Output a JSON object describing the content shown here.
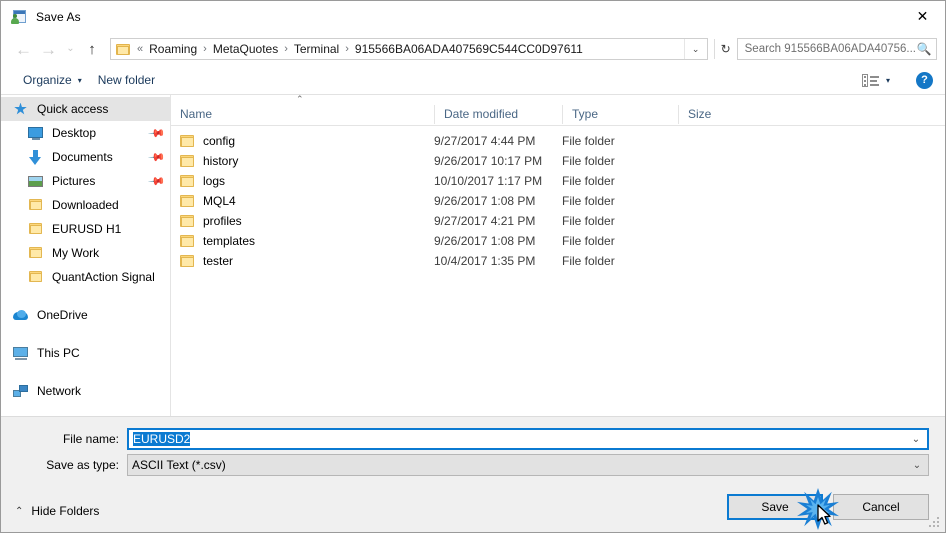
{
  "window": {
    "title": "Save As",
    "icon": "save-as-icon",
    "close_label": "✕"
  },
  "nav": {
    "back_icon": "←",
    "forward_icon": "→",
    "recent_icon": "⌄",
    "up_icon": "↑",
    "refresh_icon": "↻",
    "dropdown_icon": "⌄"
  },
  "address": {
    "leading_separator": "«",
    "crumbs": [
      "Roaming",
      "MetaQuotes",
      "Terminal",
      "915566BA06ADA407569C544CC0D97611"
    ],
    "separator": "›"
  },
  "search": {
    "placeholder": "Search 915566BA06ADA40756...",
    "icon": "search-icon"
  },
  "toolbar": {
    "organize_label": "Organize",
    "organize_caret": "▾",
    "new_folder_label": "New folder",
    "view_caret": "▾",
    "help_label": "?"
  },
  "sidebar": {
    "items": [
      {
        "label": "Quick access",
        "icon": "star-icon",
        "level": "root",
        "selected": true,
        "pinned": false
      },
      {
        "label": "Desktop",
        "icon": "desktop-icon",
        "level": "child",
        "selected": false,
        "pinned": true
      },
      {
        "label": "Documents",
        "icon": "download-arrow-icon",
        "level": "child",
        "selected": false,
        "pinned": true
      },
      {
        "label": "Pictures",
        "icon": "pictures-icon",
        "level": "child",
        "selected": false,
        "pinned": true
      },
      {
        "label": "Downloaded",
        "icon": "folder-icon",
        "level": "child",
        "selected": false,
        "pinned": false
      },
      {
        "label": "EURUSD H1",
        "icon": "folder-icon",
        "level": "child",
        "selected": false,
        "pinned": false
      },
      {
        "label": "My Work",
        "icon": "folder-icon",
        "level": "child",
        "selected": false,
        "pinned": false
      },
      {
        "label": "QuantAction Signal",
        "icon": "folder-icon",
        "level": "child",
        "selected": false,
        "pinned": false
      },
      {
        "label": "OneDrive",
        "icon": "onedrive-icon",
        "level": "root",
        "selected": false,
        "pinned": false
      },
      {
        "label": "This PC",
        "icon": "this-pc-icon",
        "level": "root",
        "selected": false,
        "pinned": false
      },
      {
        "label": "Network",
        "icon": "network-icon",
        "level": "root",
        "selected": false,
        "pinned": false
      }
    ],
    "pin_glyph": "📌"
  },
  "filelist": {
    "sort_caret": "⌃",
    "columns": [
      "Name",
      "Date modified",
      "Type",
      "Size"
    ],
    "rows": [
      {
        "name": "config",
        "date": "9/27/2017 4:44 PM",
        "type": "File folder",
        "size": ""
      },
      {
        "name": "history",
        "date": "9/26/2017 10:17 PM",
        "type": "File folder",
        "size": ""
      },
      {
        "name": "logs",
        "date": "10/10/2017 1:17 PM",
        "type": "File folder",
        "size": ""
      },
      {
        "name": "MQL4",
        "date": "9/26/2017 1:08 PM",
        "type": "File folder",
        "size": ""
      },
      {
        "name": "profiles",
        "date": "9/27/2017 4:21 PM",
        "type": "File folder",
        "size": ""
      },
      {
        "name": "templates",
        "date": "9/26/2017 1:08 PM",
        "type": "File folder",
        "size": ""
      },
      {
        "name": "tester",
        "date": "10/4/2017 1:35 PM",
        "type": "File folder",
        "size": ""
      }
    ]
  },
  "footer": {
    "file_name_label": "File name:",
    "file_name_value": "EURUSD2",
    "save_as_type_label": "Save as type:",
    "save_as_type_value": "ASCII Text (*.csv)",
    "combo_caret": "⌄",
    "hide_folders_label": "Hide Folders",
    "hide_folders_caret": "⌃",
    "save_label": "Save",
    "cancel_label": "Cancel"
  },
  "colors": {
    "accent": "#0b7ad1",
    "panel": "#f0f0f0",
    "column_header_text": "#4a6785",
    "folder_yellow": "#ffe9a8"
  }
}
